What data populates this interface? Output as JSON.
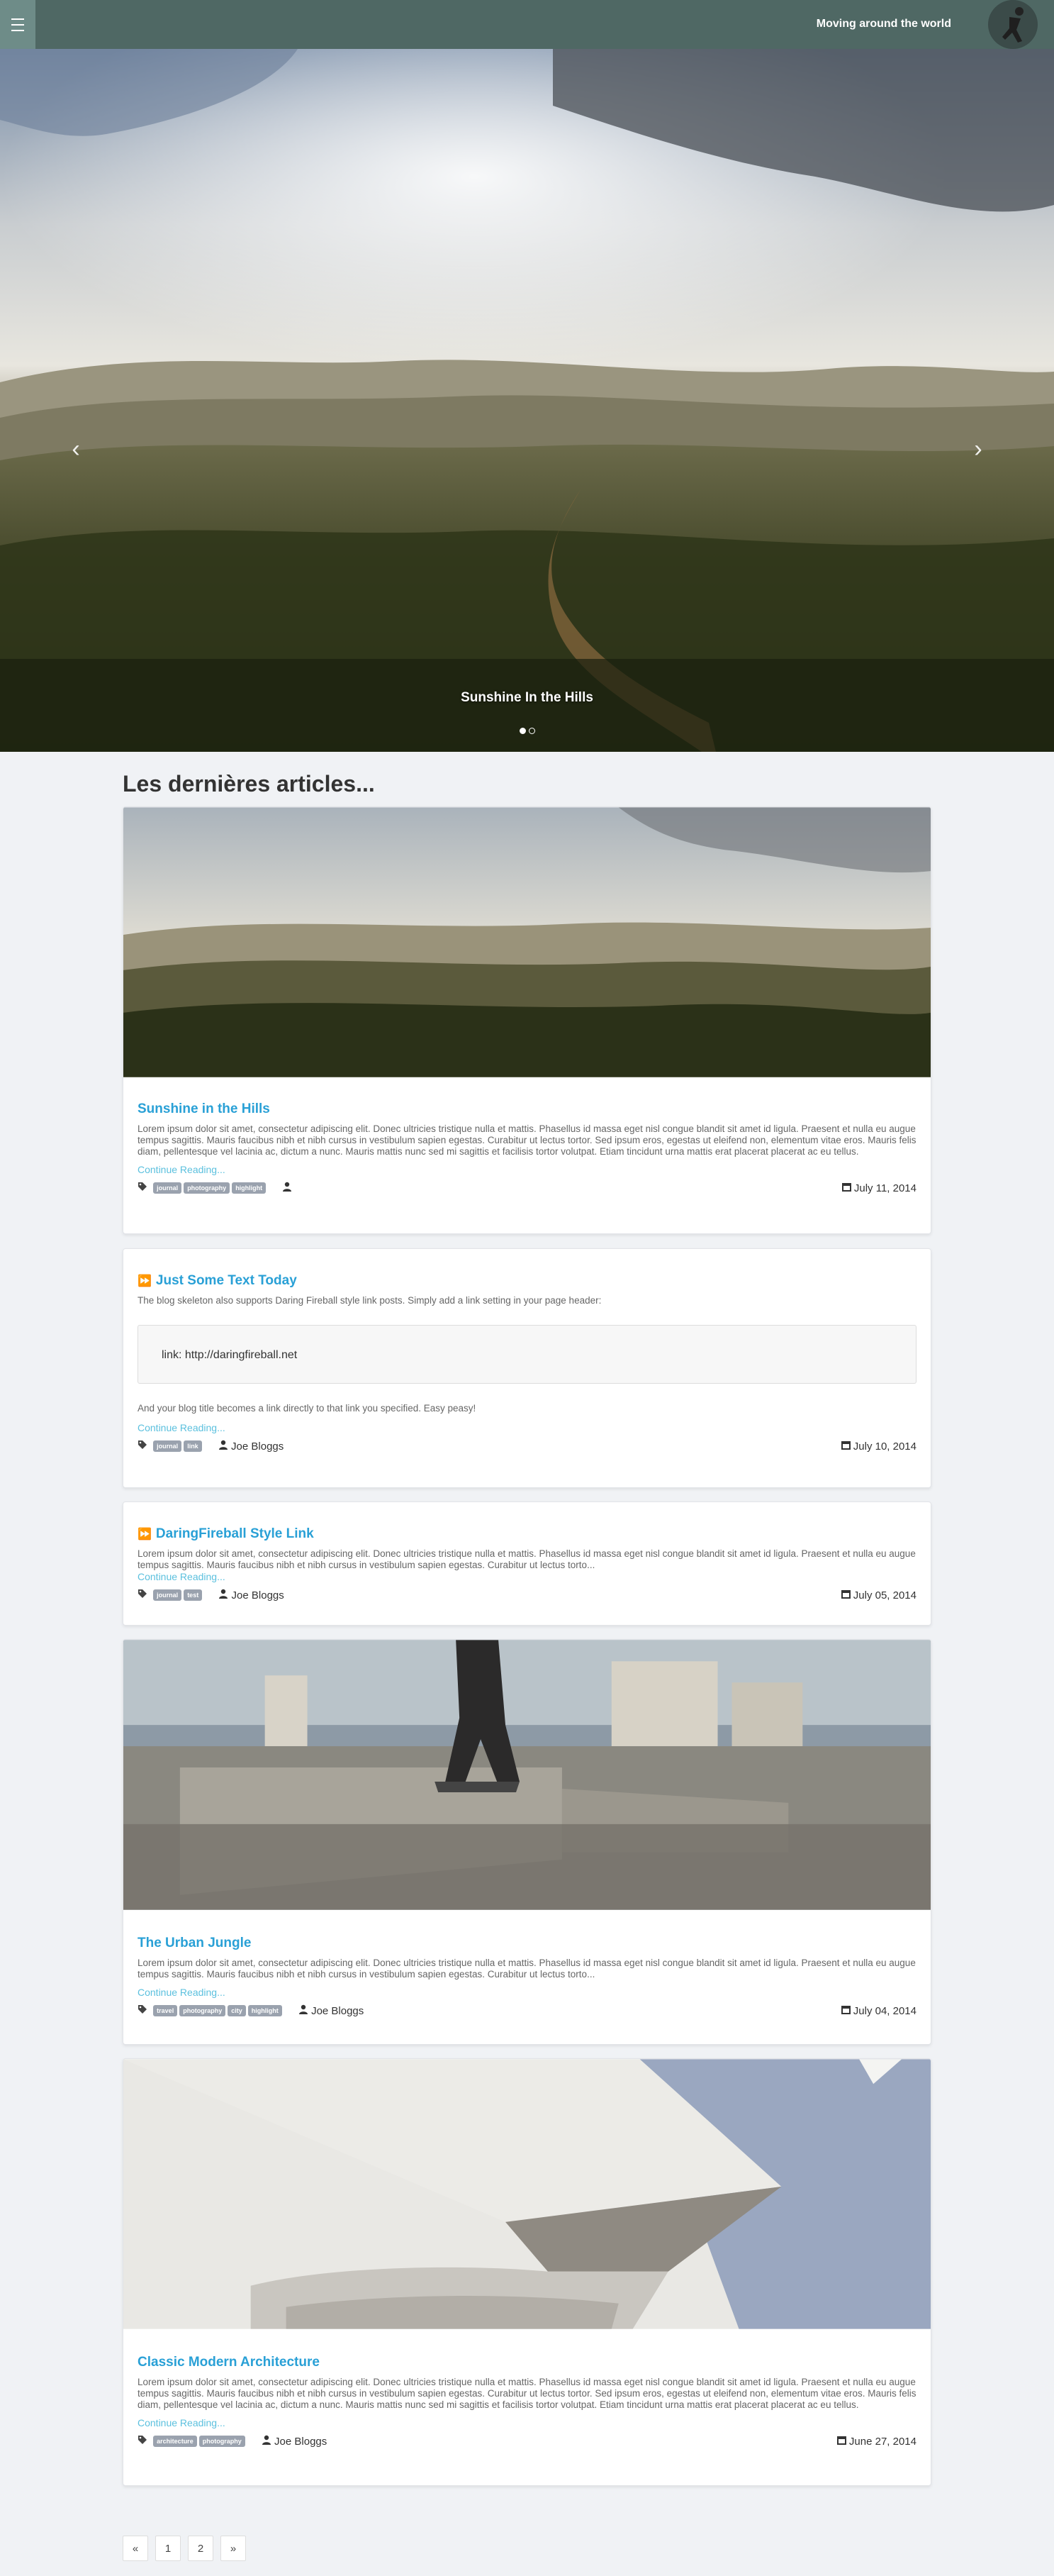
{
  "header": {
    "site_title": "Moving around the world",
    "menu_icon": "menu-icon"
  },
  "hero": {
    "caption": "Sunshine In the Hills",
    "prev_icon": "chevron-left-icon",
    "next_icon": "chevron-right-icon",
    "slide_count": 2,
    "active_slide": 1
  },
  "section_title": "Les dernières articles...",
  "posts": [
    {
      "title": "Sunshine in the Hills",
      "excerpt": "Lorem ipsum dolor sit amet, consectetur adipiscing elit. Donec ultricies tristique nulla et mattis. Phasellus id massa eget nisl congue blandit sit amet id ligula. Praesent et nulla eu augue tempus sagittis. Mauris faucibus nibh et nibh cursus in vestibulum sapien egestas. Curabitur ut lectus tortor. Sed ipsum eros, egestas ut eleifend non, elementum vitae eros. Mauris felis diam, pellentesque vel lacinia ac, dictum a nunc. Mauris mattis nunc sed mi sagittis et facilisis tortor volutpat. Etiam tincidunt urna mattis erat placerat placerat ac eu tellus.",
      "read_more": "Continue Reading...",
      "tags": [
        "journal",
        "photography",
        "highlight"
      ],
      "author": "",
      "date": "July 11, 2014"
    },
    {
      "title": "Just Some Text Today",
      "excerpt": "The blog skeleton also supports Daring Fireball style link posts. Simply add a link setting in your page header:",
      "code": "link: http://daringfireball.net",
      "excerpt2": "And your blog title becomes a link directly to that link you specified. Easy peasy!",
      "read_more": "Continue Reading...",
      "tags": [
        "journal",
        "link"
      ],
      "author": "Joe Bloggs",
      "date": "July 10, 2014"
    },
    {
      "title": "DaringFireball Style Link",
      "excerpt": "Lorem ipsum dolor sit amet, consectetur adipiscing elit. Donec ultricies tristique nulla et mattis. Phasellus id massa eget nisl congue blandit sit amet id ligula. Praesent et nulla eu augue tempus sagittis. Mauris faucibus nibh et nibh cursus in vestibulum sapien egestas. Curabitur ut lectus torto...",
      "read_more": "Continue Reading...",
      "tags": [
        "journal",
        "test"
      ],
      "author": "Joe Bloggs",
      "date": "July 05, 2014"
    },
    {
      "title": "The Urban Jungle",
      "excerpt": "Lorem ipsum dolor sit amet, consectetur adipiscing elit. Donec ultricies tristique nulla et mattis. Phasellus id massa eget nisl congue blandit sit amet id ligula. Praesent et nulla eu augue tempus sagittis. Mauris faucibus nibh et nibh cursus in vestibulum sapien egestas. Curabitur ut lectus torto...",
      "read_more": "Continue Reading...",
      "tags": [
        "travel",
        "photography",
        "city",
        "highlight"
      ],
      "author": "Joe Bloggs",
      "date": "July 04, 2014"
    },
    {
      "title": "Classic Modern Architecture",
      "excerpt": "Lorem ipsum dolor sit amet, consectetur adipiscing elit. Donec ultricies tristique nulla et mattis. Phasellus id massa eget nisl congue blandit sit amet id ligula. Praesent et nulla eu augue tempus sagittis. Mauris faucibus nibh et nibh cursus in vestibulum sapien egestas. Curabitur ut lectus tortor. Sed ipsum eros, egestas ut eleifend non, elementum vitae eros. Mauris felis diam, pellentesque vel lacinia ac, dictum a nunc. Mauris mattis nunc sed mi sagittis et facilisis tortor volutpat. Etiam tincidunt urna mattis erat placerat placerat ac eu tellus.",
      "read_more": "Continue Reading...",
      "tags": [
        "architecture",
        "photography"
      ],
      "author": "Joe Bloggs",
      "date": "June 27, 2014"
    }
  ],
  "pagination": {
    "prev": "«",
    "pages": [
      "1",
      "2"
    ],
    "next": "»"
  },
  "colors": {
    "header_bg": "#4f6864",
    "link": "#29a0d6",
    "tag_bg": "#9aa2ae",
    "page_bg": "#f0f2f5"
  }
}
